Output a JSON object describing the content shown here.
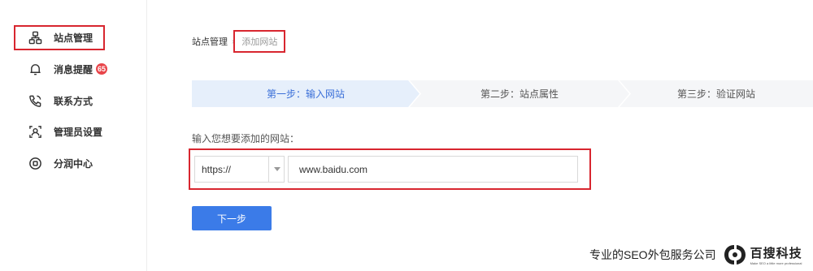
{
  "sidebar": {
    "items": [
      {
        "label": "站点管理",
        "icon": "sitemap-icon",
        "active": true
      },
      {
        "label": "消息提醒",
        "icon": "bell-icon",
        "badge": "65"
      },
      {
        "label": "联系方式",
        "icon": "phone-icon"
      },
      {
        "label": "管理员设置",
        "icon": "admin-card-icon"
      },
      {
        "label": "分润中心",
        "icon": "coin-icon"
      }
    ]
  },
  "breadcrumb": {
    "root": "站点管理",
    "separator": "›",
    "current": "添加网站"
  },
  "steps": [
    {
      "label": "第一步：输入网站",
      "active": true
    },
    {
      "label": "第二步：站点属性"
    },
    {
      "label": "第三步：验证网站"
    }
  ],
  "form": {
    "label": "输入您想要添加的网站：",
    "protocol": "https://",
    "url_value": "www.baidu.com"
  },
  "next_button": "下一步",
  "watermark": {
    "text": "专业的SEO外包服务公司",
    "brand": "百搜科技",
    "tagline": "Make SEO a little more professional"
  },
  "colors": {
    "accent": "#3b7be8",
    "highlight_border": "#d8262f",
    "badge": "#e8454a",
    "active_step_bg": "#e6effb"
  }
}
